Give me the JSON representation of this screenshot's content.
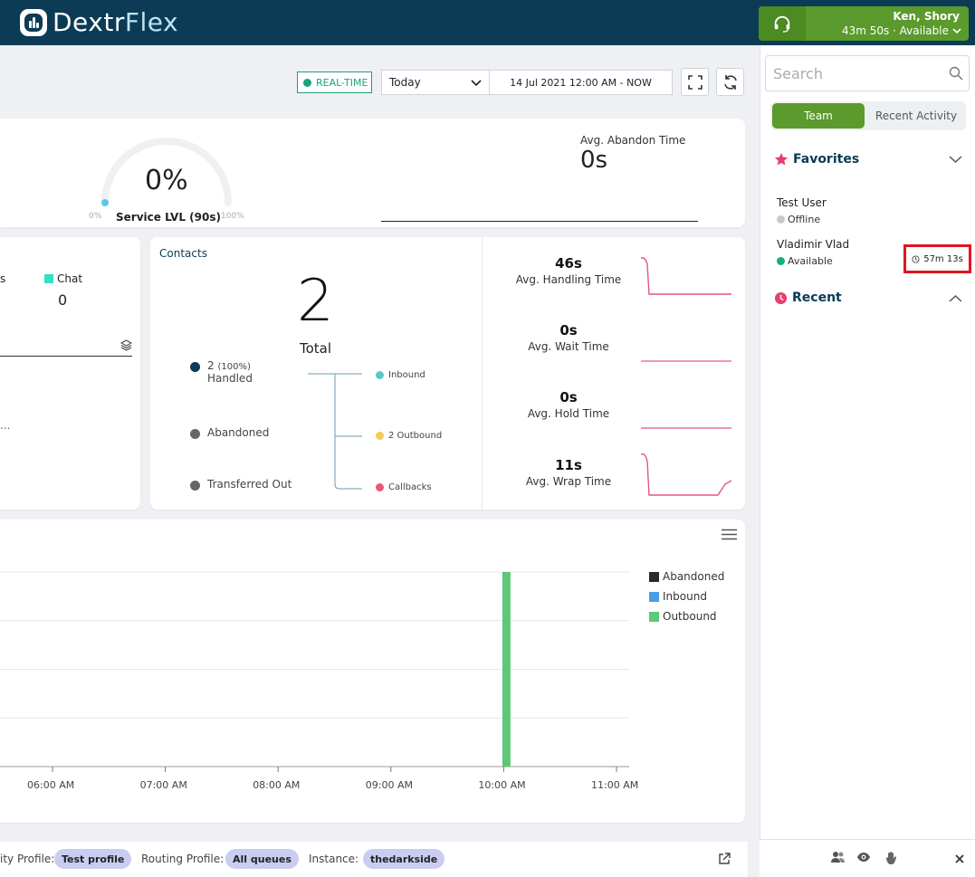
{
  "app": {
    "brand_part1": "Dextr",
    "brand_part2": "Flex"
  },
  "agent": {
    "name": "Ken, Shory",
    "status": "43m 50s · Available",
    "icon": "headset-icon"
  },
  "toolbar": {
    "realtime_label": "REAL-TIME",
    "period": "Today",
    "date_range": "14 Jul 2021 12:00 AM - NOW"
  },
  "service_level": {
    "value": "0%",
    "label": "Service LVL (90s)",
    "min": "0%",
    "max": "100%"
  },
  "abandon": {
    "label": "Avg. Abandon Time",
    "value": "0s"
  },
  "channels": {
    "partial_label": "s",
    "chat_label": "Chat",
    "chat_value": "0",
    "ellipsis": "..."
  },
  "contacts": {
    "title": "Contacts",
    "total": "2",
    "total_label": "Total",
    "handled_count": "2",
    "handled_pct": "(100%)",
    "handled_label": "Handled",
    "abandoned_label": "Abandoned",
    "transferred_label": "Transferred Out",
    "inbound_label": "Inbound",
    "outbound_label": "2 Outbound",
    "callbacks_label": "Callbacks"
  },
  "metrics": [
    {
      "value": "46s",
      "label": "Avg. Handling Time"
    },
    {
      "value": "0s",
      "label": "Avg. Wait Time"
    },
    {
      "value": "0s",
      "label": "Avg. Hold Time"
    },
    {
      "value": "11s",
      "label": "Avg. Wrap Time"
    }
  ],
  "chart_data": {
    "type": "bar",
    "categories": [
      "06:00 AM",
      "07:00 AM",
      "08:00 AM",
      "09:00 AM",
      "10:00 AM",
      "11:00 AM"
    ],
    "series": [
      {
        "name": "Abandoned",
        "color": "#2b2b2b",
        "values": [
          0,
          0,
          0,
          0,
          0,
          0
        ]
      },
      {
        "name": "Inbound",
        "color": "#4a9ee0",
        "values": [
          0,
          0,
          0,
          0,
          0,
          0
        ]
      },
      {
        "name": "Outbound",
        "color": "#5dc879",
        "values": [
          0,
          0,
          0,
          0,
          2,
          0
        ]
      }
    ],
    "ylim": [
      0,
      2
    ],
    "grid": true,
    "legend": "right"
  },
  "footer": {
    "security_label": "ity Profile:",
    "security_value": "Test profile",
    "routing_label": "Routing Profile:",
    "routing_value": "All queues",
    "instance_label": "Instance:",
    "instance_value": "thedarkside"
  },
  "panel": {
    "search_placeholder": "Search",
    "tab_team": "Team",
    "tab_recent": "Recent Activity",
    "favorites_label": "Favorites",
    "recent_label": "Recent",
    "users": [
      {
        "name": "Test User",
        "status": "Offline",
        "status_color": "#c8c8c8"
      },
      {
        "name": "Vladimir Vlad",
        "status": "Available",
        "status_color": "#16b07a",
        "timer": "57m 13s"
      }
    ]
  },
  "colors": {
    "navy": "#0b3b55",
    "green": "#5b9a2c",
    "teal": "#1aa37a",
    "sparkline": "#e8567a",
    "favorite_star": "#e83e6c"
  }
}
